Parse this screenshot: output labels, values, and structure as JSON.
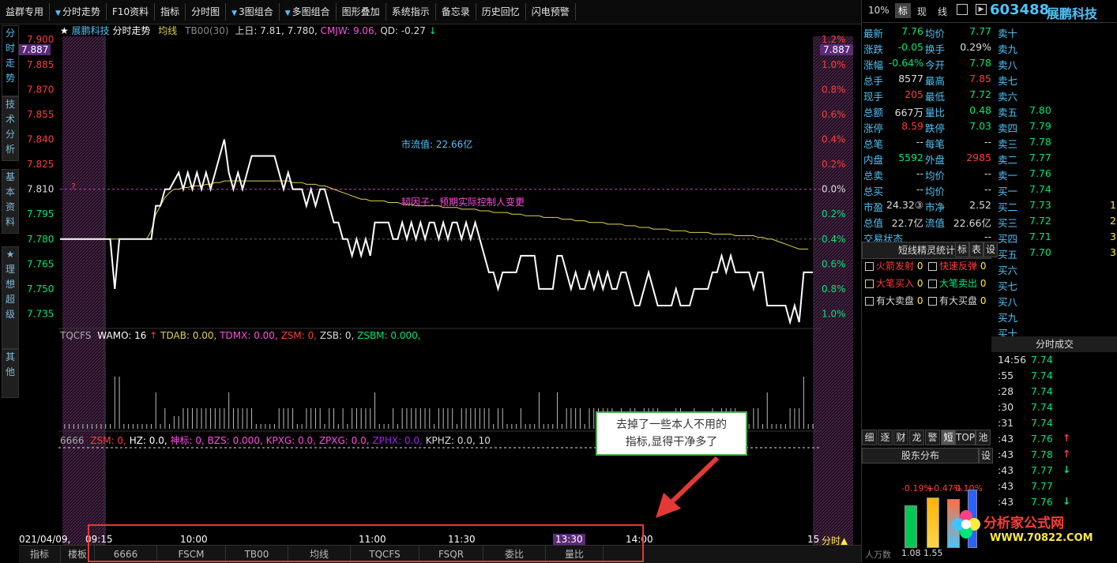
{
  "menu": [
    {
      "label": "益群专用",
      "arrow": false
    },
    {
      "label": "分时走势",
      "arrow": true
    },
    {
      "label": "F10资料",
      "arrow": false
    },
    {
      "label": "指标",
      "arrow": false
    },
    {
      "label": "分时图",
      "arrow": false
    },
    {
      "label": "3图组合",
      "arrow": true
    },
    {
      "label": "多图组合",
      "arrow": true
    },
    {
      "label": "图形叠加",
      "arrow": false
    },
    {
      "label": "系统指示",
      "arrow": false
    },
    {
      "label": "备忘录",
      "arrow": false
    },
    {
      "label": "历史回忆",
      "arrow": false
    },
    {
      "label": "闪电预警",
      "arrow": false
    }
  ],
  "left_tabs": [
    "分时走势",
    "技术分析",
    "基本资料",
    "★理想超级",
    "其他"
  ],
  "chart_header": {
    "star": "★",
    "name": "展鹏科技",
    "mode": "分时走势",
    "avg_label": "均线",
    "tb": "TB00(30)",
    "prev_close_label": "上日: 7.81,",
    "price_now": "7.780,",
    "cmjw": "CMJW: 9.06,",
    "qd": "QD: -0.27",
    "qd_arrow": "↓"
  },
  "price_current_tag": "7.887",
  "annotation_mv": "市流值: 22.66亿",
  "annotation_story": "韧因子：预期实际控制人变更",
  "question_mark": "?",
  "vol_header": {
    "name": "TQCFS",
    "wamo": "WAMO: 16",
    "wamo_arrow": "↑",
    "tdab": "TDAB: 0.00,",
    "tdmx": "TDMX: 0.00,",
    "zsm": "ZSM: 0,",
    "zsb": "ZSB: 0,",
    "zsbm": "ZSBM: 0.000,"
  },
  "ind_header": {
    "name": "6666",
    "zsm": "ZSM: 0,",
    "hz": "HZ: 0.0,",
    "shenbiao": "神标: 0,",
    "bzs": "BZS: 0.000,",
    "kpxg": "KPXG: 0.0,",
    "zpxg": "ZPXG: 0.0,",
    "zphx": "ZPHX: 0.0,",
    "kphz": "KPHZ: 0.0, 10"
  },
  "time_axis": {
    "date": "021/04/09,",
    "t0915": "09:15",
    "t1000": "10:00",
    "t1100": "11:00",
    "t1130": "11:30",
    "t1330": "13:30",
    "t1400": "14:00",
    "t15": "15",
    "fenshi": "分时",
    "fenshi_arrow": "▲"
  },
  "bottom_tabs": [
    "指标",
    "楼板",
    "6666",
    "FSCM",
    "TB00",
    "均线",
    "TQCFS",
    "FSQR",
    "委比",
    "量比"
  ],
  "annotation_box": {
    "line1": "去掉了一些本人不用的",
    "line2": "指标,显得干净多了"
  },
  "right": {
    "tabs": [
      "10%",
      "标",
      "现",
      "线"
    ],
    "code": "603488",
    "name": "展鹏科技",
    "quote": [
      {
        "l1": "最新",
        "v1": "7.76",
        "c1": "#00e676",
        "l2": "均价",
        "v2": "7.77",
        "c2": "#00e676"
      },
      {
        "l1": "涨跌",
        "v1": "-0.05",
        "c1": "#00e676",
        "l2": "换手",
        "v2": "0.29%",
        "c2": "#ddd"
      },
      {
        "l1": "涨幅",
        "v1": "-0.64%",
        "c1": "#00e676",
        "l2": "今开",
        "v2": "7.78",
        "c2": "#00e676"
      },
      {
        "l1": "总手",
        "v1": "8577",
        "c1": "#ddd",
        "l2": "最高",
        "v2": "7.85",
        "c2": "#ff3b3b"
      },
      {
        "l1": "现手",
        "v1": "205",
        "c1": "#ff3b3b",
        "l2": "最低",
        "v2": "7.72",
        "c2": "#00e676"
      },
      {
        "l1": "总额",
        "v1": "667万",
        "c1": "#ddd",
        "l2": "量比",
        "v2": "0.48",
        "c2": "#00e676"
      },
      {
        "l1": "涨停",
        "v1": "8.59",
        "c1": "#ff3b3b",
        "l2": "跌停",
        "v2": "7.03",
        "c2": "#00e676"
      },
      {
        "l1": "总笔",
        "v1": "--",
        "c1": "#ddd",
        "l2": "每笔",
        "v2": "--",
        "c2": "#ddd"
      },
      {
        "l1": "内盘",
        "v1": "5592",
        "c1": "#00e676",
        "l2": "外盘",
        "v2": "2985",
        "c2": "#ff3b3b"
      },
      {
        "l1": "总卖",
        "v1": "--",
        "c1": "#ddd",
        "l2": "均价",
        "v2": "--",
        "c2": "#ddd"
      },
      {
        "l1": "总买",
        "v1": "--",
        "c1": "#ddd",
        "l2": "均价",
        "v2": "--",
        "c2": "#ddd"
      },
      {
        "l1": "市盈",
        "v1": "24.32③",
        "c1": "#ddd",
        "l2": "市净",
        "v2": "2.52",
        "c2": "#ddd"
      },
      {
        "l1": "总值",
        "v1": "22.7亿",
        "c1": "#ddd",
        "l2": "流值",
        "v2": "22.66亿",
        "c2": "#ddd"
      },
      {
        "l1": "交易状态",
        "v1": "",
        "c1": "#ddd",
        "l2": "",
        "v2": "--",
        "c2": "#ddd"
      }
    ],
    "orderbook": [
      {
        "l": "卖十",
        "p": "",
        "v": ""
      },
      {
        "l": "卖九",
        "p": "",
        "v": ""
      },
      {
        "l": "卖八",
        "p": "",
        "v": ""
      },
      {
        "l": "卖七",
        "p": "",
        "v": ""
      },
      {
        "l": "卖六",
        "p": "",
        "v": ""
      },
      {
        "l": "卖五",
        "p": "7.80",
        "v": ""
      },
      {
        "l": "卖四",
        "p": "7.79",
        "v": ""
      },
      {
        "l": "卖三",
        "p": "7.78",
        "v": ""
      },
      {
        "l": "卖二",
        "p": "7.77",
        "v": ""
      },
      {
        "l": "卖一",
        "p": "7.76",
        "v": ""
      },
      {
        "l": "买一",
        "p": "7.74",
        "v": ""
      },
      {
        "l": "买二",
        "p": "7.73",
        "v": "1"
      },
      {
        "l": "买三",
        "p": "7.72",
        "v": "2"
      },
      {
        "l": "买四",
        "p": "7.71",
        "v": "3"
      },
      {
        "l": "买五",
        "p": "7.70",
        "v": "3"
      },
      {
        "l": "买六",
        "p": "",
        "v": ""
      },
      {
        "l": "买七",
        "p": "",
        "v": ""
      },
      {
        "l": "买八",
        "p": "",
        "v": ""
      },
      {
        "l": "买九",
        "p": "",
        "v": ""
      },
      {
        "l": "买十",
        "p": "",
        "v": ""
      }
    ],
    "spirit_title": "短线精灵统计",
    "spirit_btns": [
      "标",
      "表",
      "设"
    ],
    "signals": [
      {
        "a": "火箭发射",
        "av": "0",
        "ac": "#ff3b3b",
        "b": "快速反弹",
        "bv": "0",
        "bc": "#ff3b3b"
      },
      {
        "a": "大笔买入",
        "av": "0",
        "ac": "#ff3b3b",
        "b": "大笔卖出",
        "bv": "0",
        "bc": "#00e676"
      },
      {
        "a": "有大卖盘",
        "av": "0",
        "ac": "#ddd",
        "b": "有大买盘",
        "bv": "0",
        "bc": "#ddd"
      }
    ],
    "mini_tabs": [
      "细",
      "逐",
      "财",
      "龙",
      "警",
      "短",
      "TOP",
      "池"
    ],
    "holder": "股东分布",
    "holder_btn": "设",
    "trades_title": "分时成交",
    "trades": [
      {
        "t": "14:56",
        "p": "7.74",
        "a": ""
      },
      {
        "t": ":55",
        "p": "7.74",
        "a": ""
      },
      {
        "t": ":28",
        "p": "7.74",
        "a": ""
      },
      {
        "t": ":30",
        "p": "7.74",
        "a": ""
      },
      {
        "t": ":31",
        "p": "7.74",
        "a": ""
      },
      {
        "t": ":43",
        "p": "7.76",
        "a": "↑"
      },
      {
        "t": ":43",
        "p": "7.78",
        "a": "↑"
      },
      {
        "t": ":43",
        "p": "7.77",
        "a": "↓"
      },
      {
        "t": ":43",
        "p": "7.77",
        "a": ""
      },
      {
        "t": ":43",
        "p": "7.76",
        "a": "↓"
      }
    ],
    "gauge_labels": {
      "l1": "-0.19%",
      "l2": "+0.47%",
      "l3": "-0.10%"
    },
    "bottom_label": "人万数",
    "bottom_values": "1.08  1.55",
    "watermark": "分析家公式网",
    "watermark_url": "WWW.70822.COM"
  },
  "chart_data": {
    "type": "line",
    "y_ticks_left": [
      "7.900",
      "7.885",
      "7.870",
      "7.855",
      "7.840",
      "7.825",
      "7.810",
      "7.795",
      "7.780",
      "7.765",
      "7.750",
      "7.735"
    ],
    "y_ticks_right": [
      "1.2%",
      "1.0%",
      "0.8%",
      "0.6%",
      "0.4%",
      "0.2%",
      "0.0%",
      "0.2%",
      "0.4%",
      "0.6%",
      "0.8%",
      "1.0%"
    ],
    "ylim": [
      7.73,
      7.902
    ],
    "prev_close": 7.81,
    "price": [
      7.78,
      7.78,
      7.78,
      7.78,
      7.78,
      7.78,
      7.78,
      7.78,
      7.78,
      7.78,
      7.78,
      7.78,
      7.75,
      7.78,
      7.78,
      7.78,
      7.78,
      7.78,
      7.78,
      7.78,
      7.78,
      7.8,
      7.8,
      7.81,
      7.81,
      7.815,
      7.82,
      7.81,
      7.82,
      7.81,
      7.82,
      7.81,
      7.82,
      7.81,
      7.82,
      7.83,
      7.84,
      7.82,
      7.81,
      7.82,
      7.81,
      7.82,
      7.83,
      7.83,
      7.83,
      7.83,
      7.83,
      7.83,
      7.82,
      7.81,
      7.82,
      7.81,
      7.81,
      7.81,
      7.8,
      7.81,
      7.8,
      7.81,
      7.81,
      7.8,
      7.79,
      7.79,
      7.78,
      7.78,
      7.77,
      7.78,
      7.77,
      7.78,
      7.77,
      7.79,
      7.79,
      7.79,
      7.79,
      7.78,
      7.78,
      7.79,
      7.78,
      7.79,
      7.78,
      7.79,
      7.78,
      7.79,
      7.79,
      7.78,
      7.79,
      7.78,
      7.79,
      7.79,
      7.78,
      7.79,
      7.78,
      7.79,
      7.78,
      7.77,
      7.76,
      7.76,
      7.75,
      7.76,
      7.76,
      7.76,
      7.76,
      7.77,
      7.77,
      7.77,
      7.77,
      7.75,
      7.75,
      7.75,
      7.75,
      7.77,
      7.77,
      7.76,
      7.75,
      7.76,
      7.75,
      7.75,
      7.76,
      7.75,
      7.76,
      7.75,
      7.76,
      7.75,
      7.75,
      7.76,
      7.76,
      7.75,
      7.74,
      7.74,
      7.75,
      7.76,
      7.75,
      7.74,
      7.74,
      7.74,
      7.74,
      7.75,
      7.74,
      7.74,
      7.74,
      7.75,
      7.75,
      7.75,
      7.75,
      7.76,
      7.76,
      7.77,
      7.76,
      7.77,
      7.76,
      7.76,
      7.76,
      7.76,
      7.75,
      7.76,
      7.76,
      7.74,
      7.74,
      7.74,
      7.74,
      7.74,
      7.73,
      7.74,
      7.73,
      7.76,
      7.76,
      7.76
    ],
    "avg": [
      7.78,
      7.78,
      7.78,
      7.78,
      7.78,
      7.78,
      7.78,
      7.78,
      7.78,
      7.78,
      7.78,
      7.78,
      7.78,
      7.78,
      7.78,
      7.78,
      7.78,
      7.78,
      7.78,
      7.78,
      7.785,
      7.795,
      7.8,
      7.805,
      7.808,
      7.81,
      7.81,
      7.811,
      7.811,
      7.812,
      7.812,
      7.812,
      7.813,
      7.813,
      7.814,
      7.814,
      7.815,
      7.815,
      7.815,
      7.815,
      7.815,
      7.815,
      7.815,
      7.815,
      7.815,
      7.815,
      7.815,
      7.815,
      7.815,
      7.815,
      7.815,
      7.814,
      7.814,
      7.814,
      7.813,
      7.813,
      7.813,
      7.812,
      7.812,
      7.811,
      7.81,
      7.809,
      7.808,
      7.807,
      7.806,
      7.805,
      7.804,
      7.804,
      7.803,
      7.803,
      7.803,
      7.803,
      7.802,
      7.802,
      7.802,
      7.801,
      7.801,
      7.801,
      7.8,
      7.8,
      7.8,
      7.8,
      7.8,
      7.8,
      7.799,
      7.799,
      7.799,
      7.799,
      7.798,
      7.798,
      7.798,
      7.798,
      7.797,
      7.797,
      7.797,
      7.796,
      7.796,
      7.796,
      7.796,
      7.795,
      7.795,
      7.795,
      7.794,
      7.794,
      7.794,
      7.794,
      7.793,
      7.793,
      7.793,
      7.793,
      7.792,
      7.792,
      7.792,
      7.791,
      7.791,
      7.791,
      7.79,
      7.79,
      7.79,
      7.79,
      7.789,
      7.789,
      7.789,
      7.789,
      7.788,
      7.788,
      7.788,
      7.787,
      7.787,
      7.787,
      7.786,
      7.786,
      7.786,
      7.786,
      7.785,
      7.785,
      7.785,
      7.785,
      7.784,
      7.784,
      7.784,
      7.784,
      7.784,
      7.783,
      7.783,
      7.783,
      7.783,
      7.783,
      7.782,
      7.782,
      7.782,
      7.782,
      7.782,
      7.781,
      7.781,
      7.78,
      7.78,
      7.779,
      7.778,
      7.777,
      7.776,
      7.775,
      7.774,
      7.774,
      7.774
    ]
  }
}
